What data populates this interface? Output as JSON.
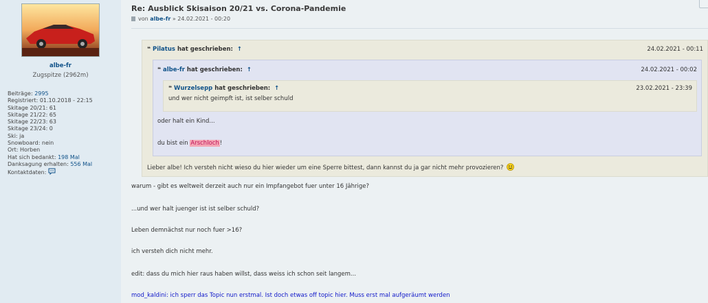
{
  "profile": {
    "username": "albe-fr",
    "rank": "Zugspitze (2962m)",
    "fields": {
      "beitraege_label": "Beiträge:",
      "beitraege_value": "2995",
      "registriert": "Registriert: 01.10.2018 - 22:15",
      "skitage_2021": "Skitage 20/21: 61",
      "skitage_2122": "Skitage 21/22: 65",
      "skitage_2223": "Skitage 22/23: 63",
      "skitage_2324": "Skitage 23/24: 0",
      "ski": "Ski: ja",
      "snowboard": "Snowboard: nein",
      "ort": "Ort: Horben",
      "bedankt_label": "Hat sich bedankt:",
      "bedankt_value": "198 Mal",
      "dank_label": "Danksagung erhalten:",
      "dank_value": "556 Mal",
      "kontakt_label": "Kontaktdaten:"
    }
  },
  "post": {
    "title": "Re: Ausblick Skisaison 20/21 vs. Corona-Pandemie",
    "author_prefix": "von",
    "author": "albe-fr",
    "date": "» 24.02.2021 - 00:20",
    "quotes": {
      "q1": {
        "name": "Pilatus",
        "suffix": "hat geschrieben:",
        "date": "24.02.2021 - 00:11",
        "text": "Lieber albe! Ich versteh nicht wieso du hier wieder um eine Sperre bittest, dann kannst du ja gar nicht mehr provozieren?"
      },
      "q2": {
        "name": "albe-fr",
        "suffix": "hat geschrieben:",
        "date": "24.02.2021 - 00:02",
        "text1": "oder halt ein Kind...",
        "text2_prefix": "du bist ein",
        "text2_highlight": "Arschloch",
        "text2_suffix": "!"
      },
      "q3": {
        "name": "Wurzelsepp",
        "suffix": "hat geschrieben:",
        "date": "23.02.2021 - 23:39",
        "text": "und wer nicht geimpft ist, ist selber schuld"
      }
    },
    "lines": [
      "warum - gibt es weltweit derzeit auch nur ein Impfangebot fuer unter 16 Jährige?",
      "...und wer halt juenger ist ist selber schuld?",
      "Leben demnächst nur noch fuer >16?",
      "ich versteh dich nicht mehr.",
      "edit: dass du mich hier raus haben willst, dass weiss ich schon seit langem..."
    ],
    "mod_note": "mod_kaldini: ich sperr das Topic nun erstmal. Ist doch etwas off topic hier. Muss erst mal aufgeräumt werden",
    "quote_mark": "❝",
    "arrow": "↑"
  },
  "colors": {
    "link": "#105289",
    "mod": "#1018c9",
    "highlight": "#f4a6b4"
  }
}
